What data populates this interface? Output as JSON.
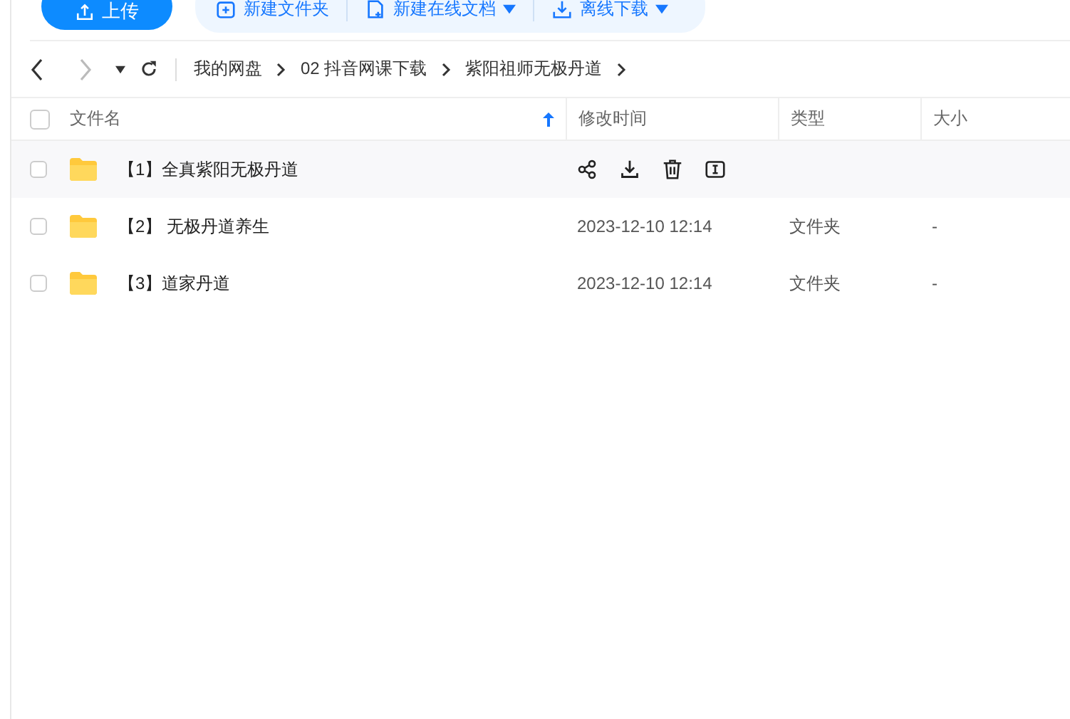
{
  "toolbar": {
    "upload": "上传",
    "actions": [
      {
        "label": "新建文件夹",
        "kind": "folder",
        "dropdown": false
      },
      {
        "label": "新建在线文档",
        "kind": "document",
        "dropdown": true
      },
      {
        "label": "离线下载",
        "kind": "download",
        "dropdown": true
      }
    ]
  },
  "breadcrumb": [
    "我的网盘",
    "02 抖音网课下载",
    "紫阳祖师无极丹道"
  ],
  "table": {
    "all_checked": false,
    "columns": [
      {
        "label": "文件名",
        "sorted": true
      },
      {
        "label": "修改时间",
        "sorted": false
      },
      {
        "label": "类型",
        "sorted": false
      },
      {
        "label": "大小",
        "sorted": false
      }
    ],
    "rows": [
      {
        "name": "【1】全真紫阳无极丹道",
        "hovered": true,
        "checked": false
      },
      {
        "name": "【2】 无极丹道养生",
        "modified": "2023-12-10 12:14",
        "type": "文件夹",
        "size": "-",
        "hovered": false,
        "checked": false
      },
      {
        "name": "【3】道家丹道",
        "modified": "2023-12-10 12:14",
        "type": "文件夹",
        "size": "-",
        "hovered": false,
        "checked": false
      }
    ]
  }
}
